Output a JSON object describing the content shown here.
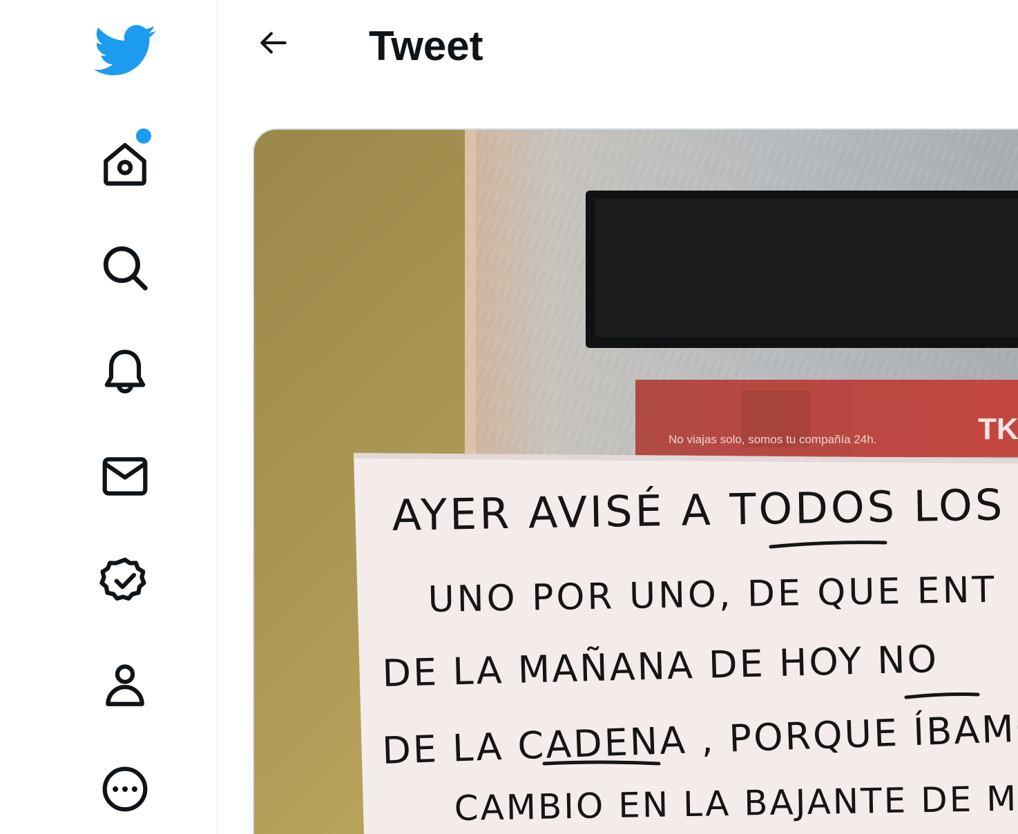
{
  "header": {
    "title": "Tweet",
    "back_label": "Back"
  },
  "sidebar": {
    "items": [
      {
        "name": "logo",
        "icon": "twitter-bird-icon"
      },
      {
        "name": "home",
        "icon": "home-icon",
        "has_notification_dot": true
      },
      {
        "name": "explore",
        "icon": "search-icon"
      },
      {
        "name": "notifications",
        "icon": "bell-icon"
      },
      {
        "name": "messages",
        "icon": "envelope-icon"
      },
      {
        "name": "verified",
        "icon": "verified-badge-icon"
      },
      {
        "name": "profile",
        "icon": "person-icon"
      },
      {
        "name": "more",
        "icon": "more-dots-icon"
      }
    ]
  },
  "media": {
    "elevator_sticker_text": "No viajas solo, somos tu compañía 24h.",
    "brand_fragment": "TK",
    "note_lines": [
      "AYER AVISÉ A TODOS LOS",
      "UNO POR UNO, DE QUE ENT",
      "DE LA MAÑANA DE HOY NO",
      "DE LA CADENA , PORQUE ÍBAMOS",
      "CAMBIO EN LA BAJANTE DE MI"
    ]
  },
  "colors": {
    "brand_blue": "#1d9bf0",
    "text_primary": "#0f1419",
    "border": "#eff3f4"
  }
}
